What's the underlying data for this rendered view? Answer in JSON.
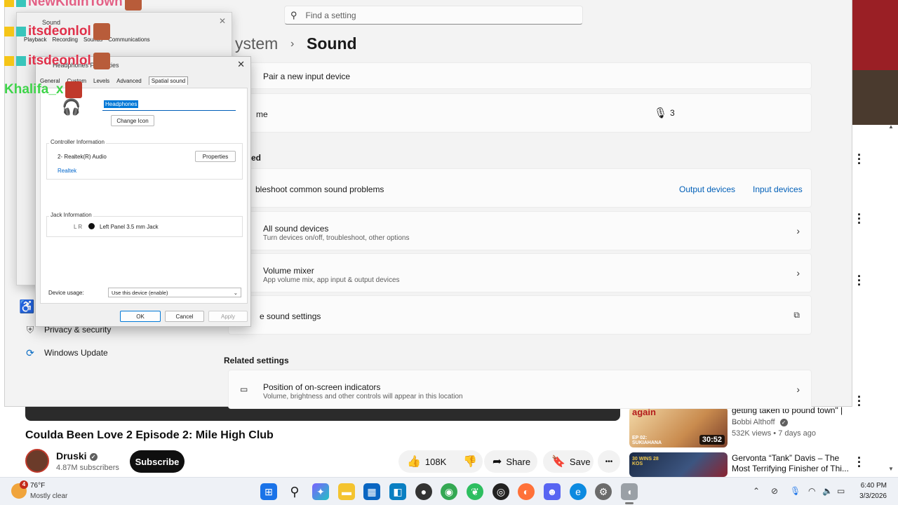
{
  "settings": {
    "search_placeholder": "Find a setting",
    "breadcrumb_parent": "ystem",
    "breadcrumb_current": "Sound",
    "pair_input": "Pair a new input device",
    "volume_partial": "me",
    "volume_value_partial": "3",
    "advanced_partial": "ed",
    "troubleshoot_partial": "bleshoot common sound problems",
    "output_devices_link": "Output devices",
    "input_devices_link": "Input devices",
    "all_devices_title": "All sound devices",
    "all_devices_sub": "Turn devices on/off, troubleshoot, other options",
    "volume_mixer_title": "Volume mixer",
    "volume_mixer_sub": "App volume mix, app input & output devices",
    "more_sound_settings_partial": "e sound settings",
    "related_settings": "Related settings",
    "indicators_title": "Position of on-screen indicators",
    "indicators_sub": "Volume, brightness and other controls will appear in this location",
    "nav": [
      {
        "label": "Privacy & security",
        "icon": "shield-icon"
      },
      {
        "label": "Windows Update",
        "icon": "update-icon"
      }
    ]
  },
  "sound_dialog": {
    "title": "Sound",
    "tabs": [
      "Playback",
      "Recording",
      "Sounds",
      "Communications"
    ]
  },
  "hp_dialog": {
    "title": "Headphones Properties",
    "tabs": [
      "General",
      "Custom",
      "Levels",
      "Advanced",
      "Spatial sound"
    ],
    "name_value": "Headphones",
    "change_icon": "Change Icon",
    "controller_label": "Controller Information",
    "controller_name": "2- Realtek(R) Audio",
    "controller_vendor": "Realtek",
    "properties_btn": "Properties",
    "jack_label": "Jack Information",
    "jack_lr": "L R",
    "jack_desc": "Left Panel 3.5 mm Jack",
    "device_usage_label": "Device usage:",
    "device_usage_value": "Use this device (enable)",
    "ok": "OK",
    "cancel": "Cancel",
    "apply": "Apply"
  },
  "chat": [
    {
      "name": "NewKidInTown",
      "color": "#e03c6a"
    },
    {
      "name": "itsdeonlol",
      "color": "#e0304a"
    },
    {
      "name": "itsdeonlol",
      "color": "#e0304a"
    },
    {
      "name": "Khalifa_x",
      "color": "#3fd44a"
    }
  ],
  "youtube": {
    "video_title": "Coulda Been Love 2 Episode 2: Mile High Club",
    "channel": "Druski",
    "subscribers": "4.87M subscribers",
    "subscribe": "Subscribe",
    "likes": "108K",
    "share": "Share",
    "save": "Save",
    "more": "•••",
    "recs": [
      {
        "title": "getting taken to pound town\" | ...",
        "channel": "Bobbi Althoff",
        "meta": "532K views • 7 days ago",
        "duration": "30:52",
        "thumb_text": "EP 02: SUKIAHANA",
        "thumb_top": "again"
      },
      {
        "title": "Gervonta “Tank” Davis – The Most Terrifying Finisher of Thi...",
        "channel": "",
        "meta": "",
        "duration": "",
        "thumb_text": "30 WINS 28 KOS",
        "thumb_top": ""
      }
    ]
  },
  "taskbar": {
    "weather_badge": "4",
    "temperature": "76°F",
    "condition": "Mostly clear",
    "time": "6:40 PM",
    "date": "3/3/2026",
    "apps": [
      {
        "name": "windows-start-icon",
        "color": "#1a73e8"
      },
      {
        "name": "search-icon",
        "color": "#1a1a1a"
      },
      {
        "name": "copilot-icon",
        "color": "#7b61ff"
      },
      {
        "name": "file-explorer-icon",
        "color": "#f4c430"
      },
      {
        "name": "store-icon",
        "color": "#0a66c2"
      },
      {
        "name": "app-blue-icon",
        "color": "#0a7fc2"
      },
      {
        "name": "game-icon",
        "color": "#333333"
      },
      {
        "name": "chrome-icon",
        "color": "#34a853"
      },
      {
        "name": "evernote-icon",
        "color": "#2dbe60"
      },
      {
        "name": "obs-icon",
        "color": "#222222"
      },
      {
        "name": "firefox-icon",
        "color": "#ff7139"
      },
      {
        "name": "discord-icon",
        "color": "#5865f2"
      },
      {
        "name": "edge-icon",
        "color": "#0c8ae0"
      },
      {
        "name": "settings-icon",
        "color": "#6b6b6b"
      },
      {
        "name": "headset-icon",
        "color": "#9aa0a6"
      }
    ]
  }
}
